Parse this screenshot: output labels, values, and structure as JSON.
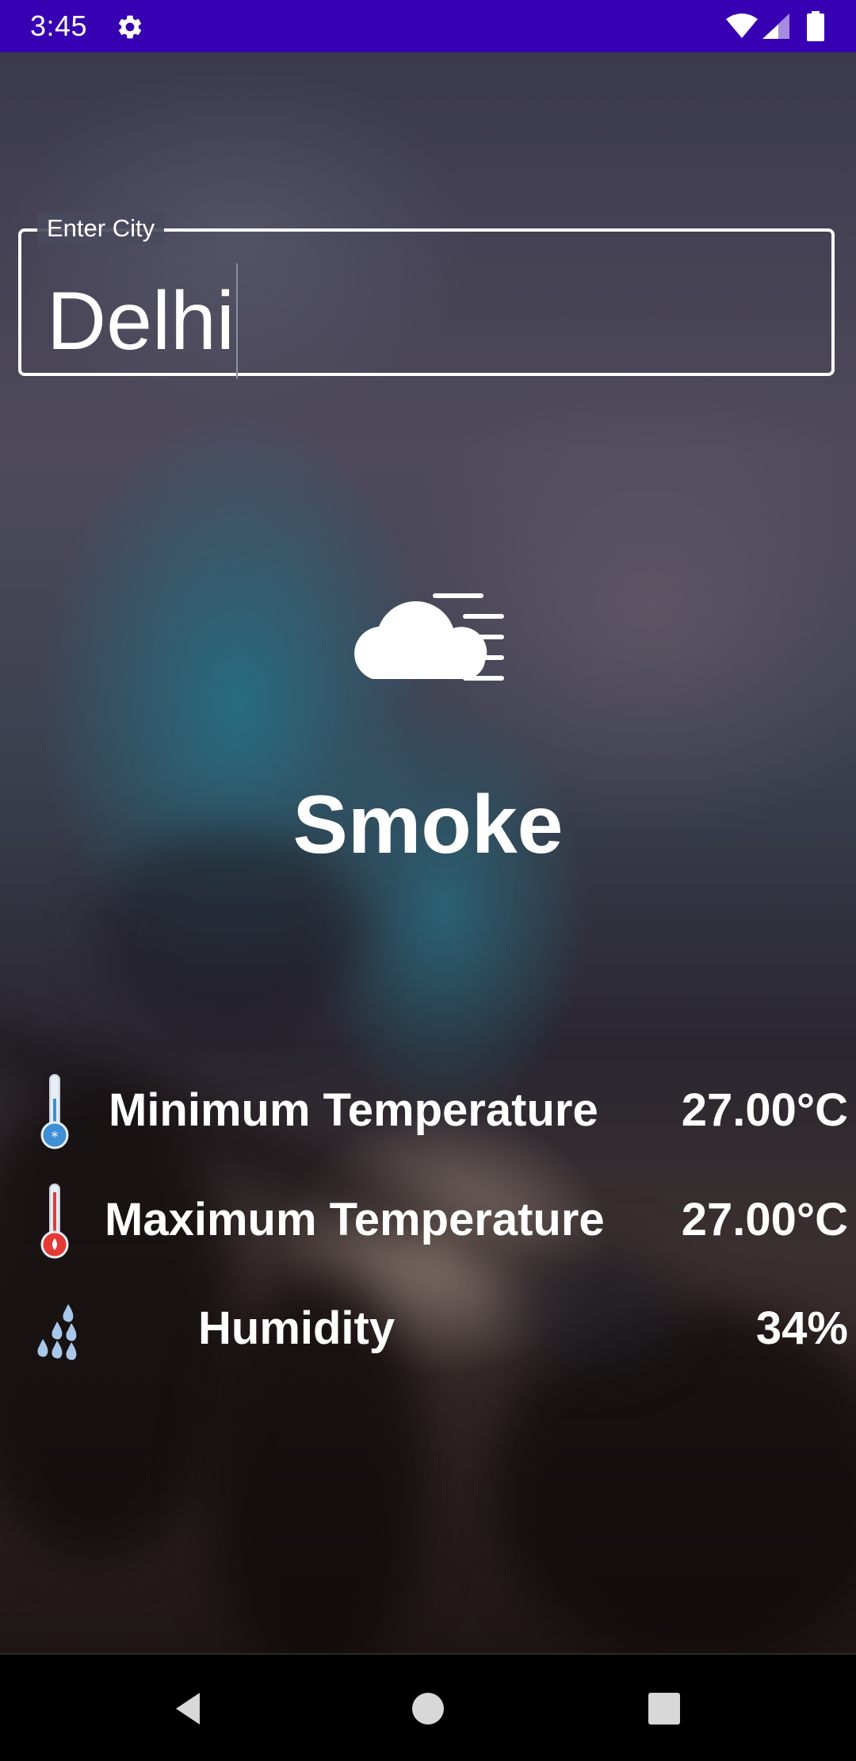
{
  "status_bar": {
    "time": "3:45",
    "icons": [
      "settings-icon",
      "wifi-icon",
      "cell-signal-icon",
      "battery-icon"
    ],
    "color": "#3700b3"
  },
  "city_input": {
    "label": "Enter City",
    "value": "Delhi"
  },
  "weather": {
    "icon": "cloud-wind-icon",
    "description": "Smoke"
  },
  "details": [
    {
      "icon": "thermometer-cold-icon",
      "label": "Minimum Temperature",
      "value": "27.00°C"
    },
    {
      "icon": "thermometer-hot-icon",
      "label": "Maximum Temperature",
      "value": "27.00°C"
    },
    {
      "icon": "humidity-drops-icon",
      "label": "Humidity",
      "value": "34%"
    }
  ],
  "nav_bar": {
    "buttons": [
      "back-icon",
      "home-icon",
      "recents-icon"
    ]
  },
  "colors": {
    "text": "#ffffff",
    "cold_accent": "#3d8fd6",
    "hot_accent": "#e53935",
    "humidity_accent": "#a8c8ea"
  }
}
